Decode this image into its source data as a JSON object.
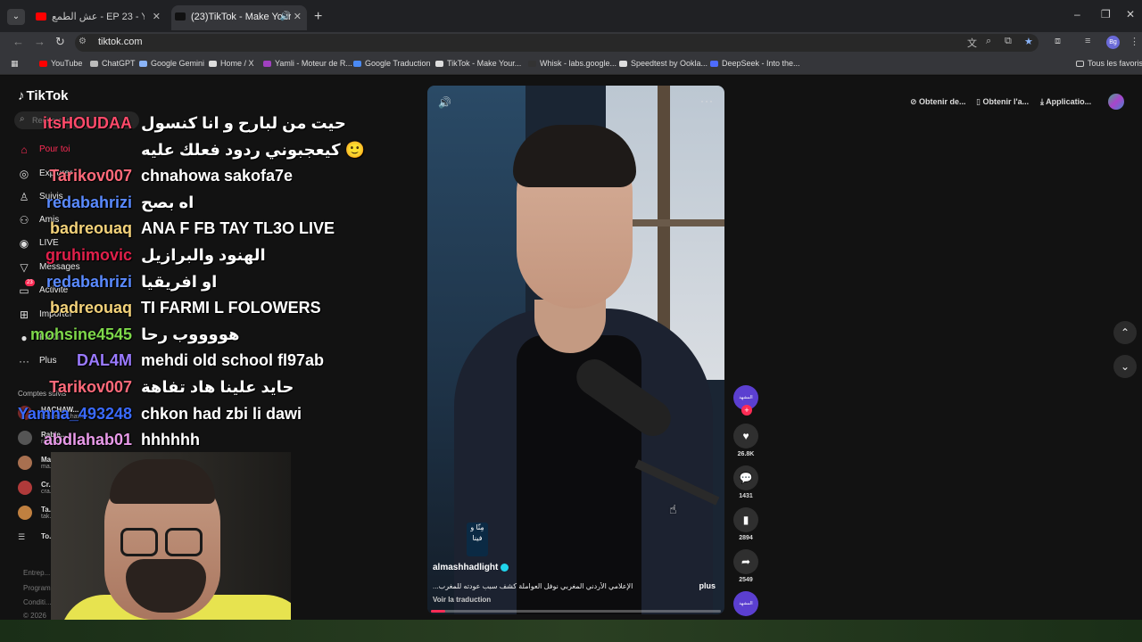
{
  "browser": {
    "tabs": [
      {
        "title": "عش الطمع - EP 23 - YouTube",
        "favicon_color": "#ff0000"
      },
      {
        "title": "(23)TikTok - Make Your Day",
        "favicon_color": "#111111"
      }
    ],
    "url": "tiktok.com",
    "bookmarks": [
      {
        "label": "YouTube",
        "color": "#ff0000"
      },
      {
        "label": "ChatGPT",
        "color": "#bbbbbb"
      },
      {
        "label": "Google Gemini",
        "color": "#8ab4f8"
      },
      {
        "label": "Home / X",
        "color": "#dddddd"
      },
      {
        "label": "Yamli - Moteur de R...",
        "color": "#a040c0"
      },
      {
        "label": "Google Traduction",
        "color": "#4a8af4"
      },
      {
        "label": "TikTok - Make Your...",
        "color": "#dddddd"
      },
      {
        "label": "Whisk - labs.google...",
        "color": "#333333"
      },
      {
        "label": "Speedtest by Ookla...",
        "color": "#dddddd"
      },
      {
        "label": "DeepSeek - Into the...",
        "color": "#4d6bfe"
      }
    ],
    "all_bookmarks": "Tous les favoris",
    "profile_initials": "Bg"
  },
  "tiktok": {
    "logo": "TikTok",
    "search_placeholder": "Rechercher",
    "nav": [
      {
        "label": "Pour toi",
        "icon": "home-icon",
        "active": true
      },
      {
        "label": "Explorer",
        "icon": "compass-icon"
      },
      {
        "label": "Suivis",
        "icon": "user-icon"
      },
      {
        "label": "Amis",
        "icon": "friends-icon"
      },
      {
        "label": "LIVE",
        "icon": "live-icon"
      },
      {
        "label": "Messages",
        "icon": "send-icon"
      },
      {
        "label": "Activité",
        "icon": "inbox-icon",
        "badge": "23"
      },
      {
        "label": "Importer",
        "icon": "plus-square-icon"
      },
      {
        "label": "Profil",
        "icon": "avatar-icon"
      },
      {
        "label": "Plus",
        "icon": "more-icon"
      }
    ],
    "followed_title": "Comptes suivis",
    "followed": [
      {
        "name": "HACHAW...",
        "sub": "benzehrachawki"
      },
      {
        "name": "Rabie...",
        "sub": "raabie13"
      },
      {
        "name": "Ma...",
        "sub": "ma..."
      },
      {
        "name": "Cr...",
        "sub": "cra..."
      },
      {
        "name": "Ta...",
        "sub": "tak..."
      },
      {
        "name": "To...",
        "sub": ""
      }
    ],
    "footer": [
      "Entrep...",
      "Program...",
      "Conditi...",
      "© 2026"
    ],
    "top_actions": [
      "Obtenir de...",
      "Obtenir l'a...",
      "Applicatio..."
    ],
    "video": {
      "author": "almashhadlight",
      "caption": "الإعلامي الأردني المغربي نوفل العواملة كشف سبب عودته للمغرب...",
      "more": "plus",
      "translate": "Voir la traduction",
      "watermark": "مِنّا و فينا",
      "progress": 0.05
    },
    "actions": {
      "likes": "26.8K",
      "comments": "1431",
      "saves": "2894",
      "shares": "2549"
    },
    "creator_avatar_text": "المشهد"
  },
  "chat": [
    {
      "user": "itsHOUDAA",
      "color": "#ff4a6a",
      "msg": "حيت من لبارح و انا كنسول"
    },
    {
      "user": "",
      "color": "#ffffff",
      "msg": "كيعجبوني ردود فعلك عليه 🙂"
    },
    {
      "user": "Tarikov007",
      "color": "#ff6a7a",
      "msg": "chnahowa sakofa7e"
    },
    {
      "user": "redabahrizi",
      "color": "#5a8aff",
      "msg": "اه بصح"
    },
    {
      "user": "badreouaq",
      "color": "#f3d27a",
      "msg": "ANA F FB TAY TL3O LIVE"
    },
    {
      "user": "ɡruhimovic",
      "color": "#e0204a",
      "msg": "الهنود والبرازيل"
    },
    {
      "user": "redabahrizi",
      "color": "#5a8aff",
      "msg": "او افريقيا"
    },
    {
      "user": "badreouaq",
      "color": "#f3d27a",
      "msg": "TI FARMI L FOLOWERS"
    },
    {
      "user": "mohsine4545",
      "color": "#7ed84a",
      "msg": "هووووب رحا"
    },
    {
      "user": "DAL4M",
      "color": "#9a7aff",
      "msg": "mehdi old school fl97ab"
    },
    {
      "user": "Tarikov007",
      "color": "#ff6a7a",
      "msg": "حايد علينا هاد تفاهة"
    },
    {
      "user": "Yamna_493248",
      "color": "#3a6aff",
      "msg": "chkon had zbi li dawi"
    },
    {
      "user": "abdlahab01",
      "color": "#e89ae8",
      "msg": "hhhhhh"
    }
  ]
}
